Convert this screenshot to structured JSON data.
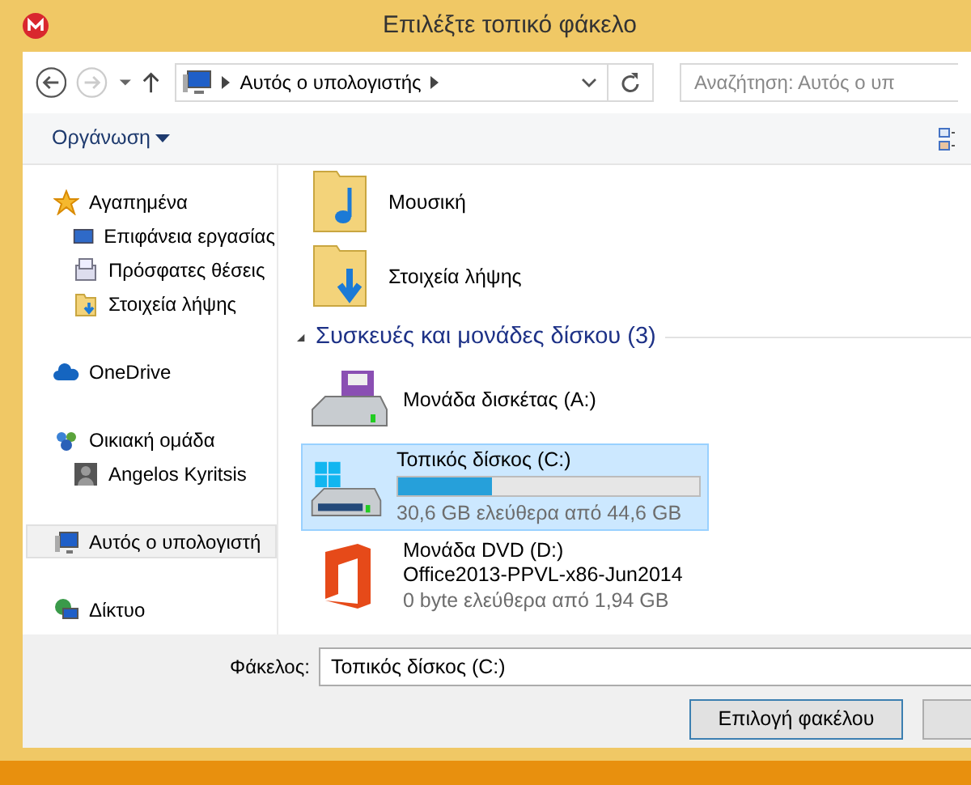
{
  "window": {
    "title": "Επιλέξτε τοπικό φάκελο"
  },
  "address": {
    "path": "Αυτός ο υπολογιστής"
  },
  "search": {
    "placeholder": "Αναζήτηση: Αυτός ο υπ"
  },
  "toolbar": {
    "organize": "Οργάνωση"
  },
  "sidebar": {
    "groups": [
      {
        "label": "Αγαπημένα",
        "kind": "star",
        "selected": false,
        "children": [
          {
            "label": "Επιφάνεια εργασίας",
            "kind": "desktop",
            "selected": false
          },
          {
            "label": "Πρόσφατες θέσεις",
            "kind": "recent",
            "selected": false
          },
          {
            "label": "Στοιχεία λήψης",
            "kind": "downloads",
            "selected": false
          }
        ]
      },
      {
        "label": "OneDrive",
        "kind": "cloud",
        "selected": false
      },
      {
        "label": "Οικιακή ομάδα",
        "kind": "homegroup",
        "selected": false,
        "children": [
          {
            "label": "Angelos Kyritsis",
            "kind": "user",
            "selected": false
          }
        ]
      },
      {
        "label": "Αυτός ο υπολογιστή",
        "kind": "computer",
        "selected": true
      },
      {
        "label": "Δίκτυο",
        "kind": "network",
        "selected": false
      }
    ]
  },
  "folders": [
    {
      "name": "Μουσική",
      "kind": "music"
    },
    {
      "name": "Στοιχεία λήψης",
      "kind": "downloads"
    }
  ],
  "devices": {
    "header": "Συσκευές και μονάδες δίσκου (3)",
    "expanded": true,
    "items": [
      {
        "kind": "floppy",
        "name": "Μονάδα δισκέτας (A:)",
        "selected": false
      },
      {
        "kind": "disk",
        "name": "Τοπικός δίσκος (C:)",
        "level": 0.314,
        "free": "30,6 GB ελεύθερα από 44,6 GB",
        "selected": true
      },
      {
        "kind": "dvd",
        "name": "Μονάδα DVD (D:)",
        "label": "Office2013-PPVL-x86-Jun2014",
        "free": "0 byte ελεύθερα από 1,94 GB",
        "selected": false
      }
    ]
  },
  "footer": {
    "label": "Φάκελος:",
    "value": "Τοπικός δίσκος (C:)",
    "buttons": [
      "Επιλογή φακέλου"
    ]
  }
}
